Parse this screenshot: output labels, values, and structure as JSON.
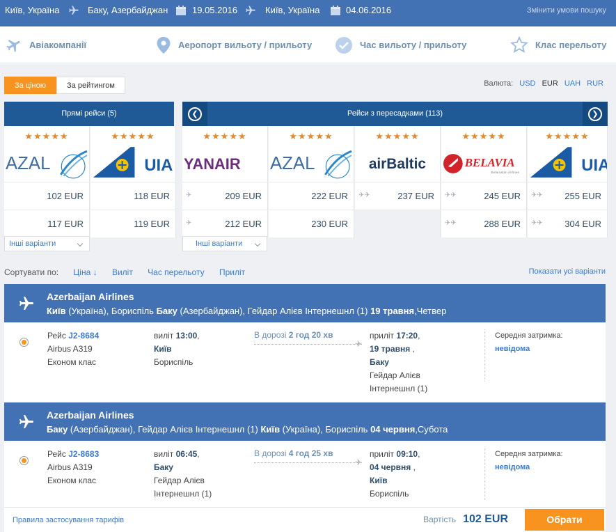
{
  "search": {
    "origin": "Київ, Україна",
    "destination": "Баку, Азербайджан",
    "depart_date": "19.05.2016",
    "return_origin": "Київ, Україна",
    "return_date": "04.06.2016",
    "change_label": "Змінити умови пошуку"
  },
  "filters": {
    "airlines": "Авіакомпанії",
    "airport": "Аеропорт вильоту / прильоту",
    "time": "Час вильоту / прильоту",
    "class": "Клас перельоту"
  },
  "sort_mode": {
    "by_price": "За ціною",
    "by_rating": "За рейтингом"
  },
  "currency": {
    "label": "Валюта:",
    "options": [
      "USD",
      "EUR",
      "UAH",
      "RUR"
    ],
    "selected": "EUR"
  },
  "direct": {
    "title": "Прямі рейси (5)",
    "more": "Інші варіанти",
    "airlines": [
      {
        "name": "AZAL",
        "stars": "★★★★★",
        "prices": [
          "102 EUR",
          "117 EUR"
        ]
      },
      {
        "name": "UIA",
        "stars": "★★★★★",
        "prices": [
          "118 EUR",
          "119 EUR"
        ]
      }
    ]
  },
  "transfer": {
    "title": "Рейси з пересадками (113)",
    "more": "Інші варіанти",
    "airlines": [
      {
        "name": "YANAIR",
        "stars": "★★★★★",
        "prices": [
          "209 EUR",
          "212 EUR"
        ]
      },
      {
        "name": "AZAL",
        "stars": "★★★★★",
        "prices": [
          "222 EUR",
          "230 EUR"
        ]
      },
      {
        "name": "airBaltic",
        "stars": "★★★★★",
        "prices": [
          "237 EUR",
          ""
        ]
      },
      {
        "name": "BELAVIA",
        "tagline": "Belarusian Airlines",
        "stars": "★★★★★",
        "prices": [
          "245 EUR",
          "288 EUR"
        ]
      },
      {
        "name": "UIA",
        "stars": "★★★★★",
        "prices": [
          "255 EUR",
          "304 EUR"
        ]
      }
    ]
  },
  "sortbar": {
    "label": "Сортувати по:",
    "price": "Ціна ↓",
    "departure": "Виліт",
    "duration": "Час перельоту",
    "arrival": "Приліт",
    "show_all": "Показати усі варіанти"
  },
  "flights": [
    {
      "airline": "Azerbaijan Airlines",
      "from_city": "Київ",
      "from_rest": " (Україна), Бориспіль ",
      "to_city": "Баку",
      "to_rest": " (Азербайджан), Гейдар Алієв Інтернешнл (1) ",
      "date": "19 травня",
      "weekday": ",Четвер",
      "flight_label": "Рейс",
      "flight_no": "J2-8684",
      "aircraft": "Airbus A319",
      "cabin": "Економ клас",
      "dep_label": "виліт",
      "dep_time": "13:00",
      "dep_city": "Київ",
      "dep_airport": "Бориспіль",
      "dep_airport2": "",
      "dur_label": "В дорозі",
      "duration": "2 год 20 хв",
      "arr_label": "приліт",
      "arr_time": "17:20",
      "arr_date": "19 травня",
      "arr_city": "Баку",
      "arr_airport": "Гейдар Алієв",
      "arr_airport2": "Інтернешнл (1)",
      "delay_label": "Середня затримка:",
      "delay": "невідома"
    },
    {
      "airline": "Azerbaijan Airlines",
      "from_city": "Баку",
      "from_rest": " (Азербайджан), Гейдар Алієв Інтернешнл (1) ",
      "to_city": "Київ",
      "to_rest": " (Україна), Бориспіль ",
      "date": "04 червня",
      "weekday": ",Субота",
      "flight_label": "Рейс",
      "flight_no": "J2-8683",
      "aircraft": "Airbus A319",
      "cabin": "Економ клас",
      "dep_label": "виліт",
      "dep_time": "06:45",
      "dep_city": "Баку",
      "dep_airport": "Гейдар Алієв",
      "dep_airport2": "Інтернешнл (1)",
      "dur_label": "В дорозі",
      "duration": "4 год 25 хв",
      "arr_label": "приліт",
      "arr_time": "09:10",
      "arr_date": "04 червня",
      "arr_city": "Київ",
      "arr_airport": "Бориспіль",
      "arr_airport2": "",
      "delay_label": "Середня затримка:",
      "delay": "невідома"
    }
  ],
  "footer": {
    "rules": "Правила застосування тарифів",
    "price_label": "Вартість",
    "price": "102 EUR",
    "buy": "Обрати"
  },
  "colors": {
    "topbar": "#4272b4",
    "accent": "#f7931e",
    "header_dark": "#1f5a96",
    "link": "#3a7bd5"
  }
}
